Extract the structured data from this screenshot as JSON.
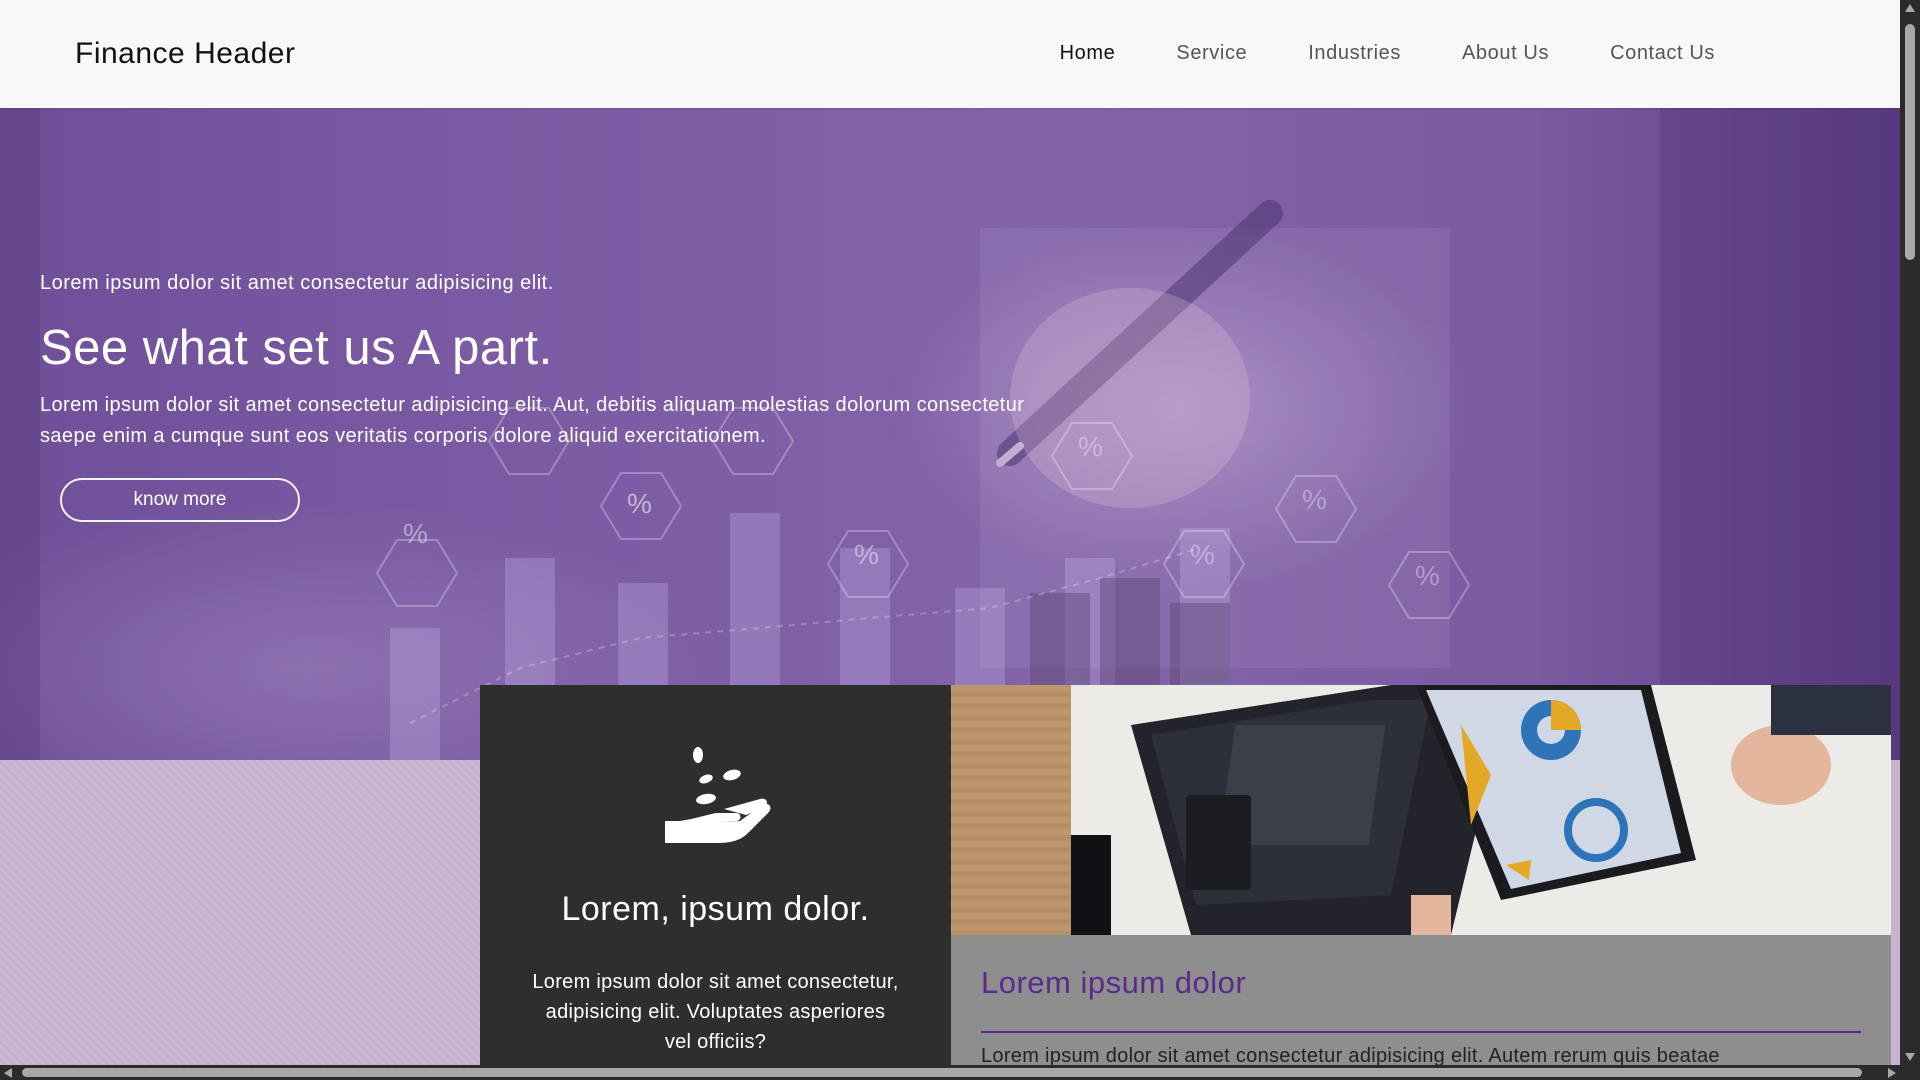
{
  "header": {
    "brand": "Finance Header",
    "nav": [
      {
        "label": "Home",
        "active": true
      },
      {
        "label": "Service",
        "active": false
      },
      {
        "label": "Industries",
        "active": false
      },
      {
        "label": "About Us",
        "active": false
      },
      {
        "label": "Contact Us",
        "active": false
      }
    ]
  },
  "hero": {
    "subtitle": "Lorem ipsum dolor sit amet consectetur adipisicing elit.",
    "title": "See what set us A part.",
    "description": "Lorem ipsum dolor sit amet consectetur adipisicing elit. Aut, debitis aliquam molestias dolorum consectetur saepe enim a cumque sunt eos veritatis corporis dolore aliquid exercitationem.",
    "button_label": "know more",
    "hex_symbol": "%"
  },
  "feature_card": {
    "icon": "hand-coins-icon",
    "title": "Lorem, ipsum dolor.",
    "text": "Lorem ipsum dolor sit amet consectetur, adipisicing elit. Voluptates asperiores vel officiis?"
  },
  "image_card": {
    "title": "Lorem ipsum dolor",
    "text": "Lorem ipsum dolor sit amet consectetur adipisicing elit. Autem rerum quis beatae"
  },
  "colors": {
    "hero_purple": "#7a5aa2",
    "accent_purple": "#5a2a8c",
    "dark_card": "#2e2e2e",
    "gray_card": "#8e8e8e"
  }
}
